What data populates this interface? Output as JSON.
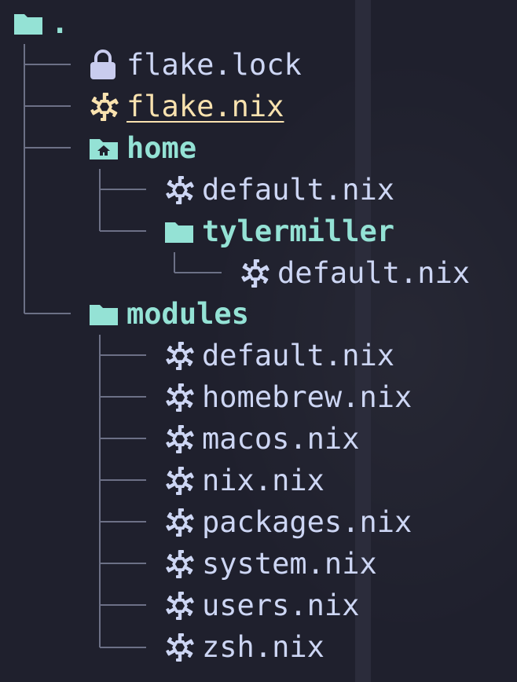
{
  "colors": {
    "background": "#1f202d",
    "directory": "#94e2d5",
    "file": "#cdd6f4",
    "active_file": "#f9e2af",
    "tree_line": "#6c7086"
  },
  "tree": {
    "root": {
      "label": ".",
      "icon": "folder-icon"
    },
    "entries": [
      {
        "label": "flake.lock",
        "icon": "lock-icon"
      },
      {
        "label": "flake.nix",
        "icon": "nix-snowflake-icon",
        "state": "active"
      },
      {
        "label": "home",
        "icon": "home-folder-icon"
      },
      {
        "label": "default.nix",
        "icon": "nix-snowflake-icon"
      },
      {
        "label": "tylermiller",
        "icon": "folder-icon"
      },
      {
        "label": "default.nix",
        "icon": "nix-snowflake-icon"
      },
      {
        "label": "modules",
        "icon": "folder-icon"
      },
      {
        "label": "default.nix",
        "icon": "nix-snowflake-icon"
      },
      {
        "label": "homebrew.nix",
        "icon": "nix-snowflake-icon"
      },
      {
        "label": "macos.nix",
        "icon": "nix-snowflake-icon"
      },
      {
        "label": "nix.nix",
        "icon": "nix-snowflake-icon"
      },
      {
        "label": "packages.nix",
        "icon": "nix-snowflake-icon"
      },
      {
        "label": "system.nix",
        "icon": "nix-snowflake-icon"
      },
      {
        "label": "users.nix",
        "icon": "nix-snowflake-icon"
      },
      {
        "label": "zsh.nix",
        "icon": "nix-snowflake-icon"
      }
    ]
  }
}
